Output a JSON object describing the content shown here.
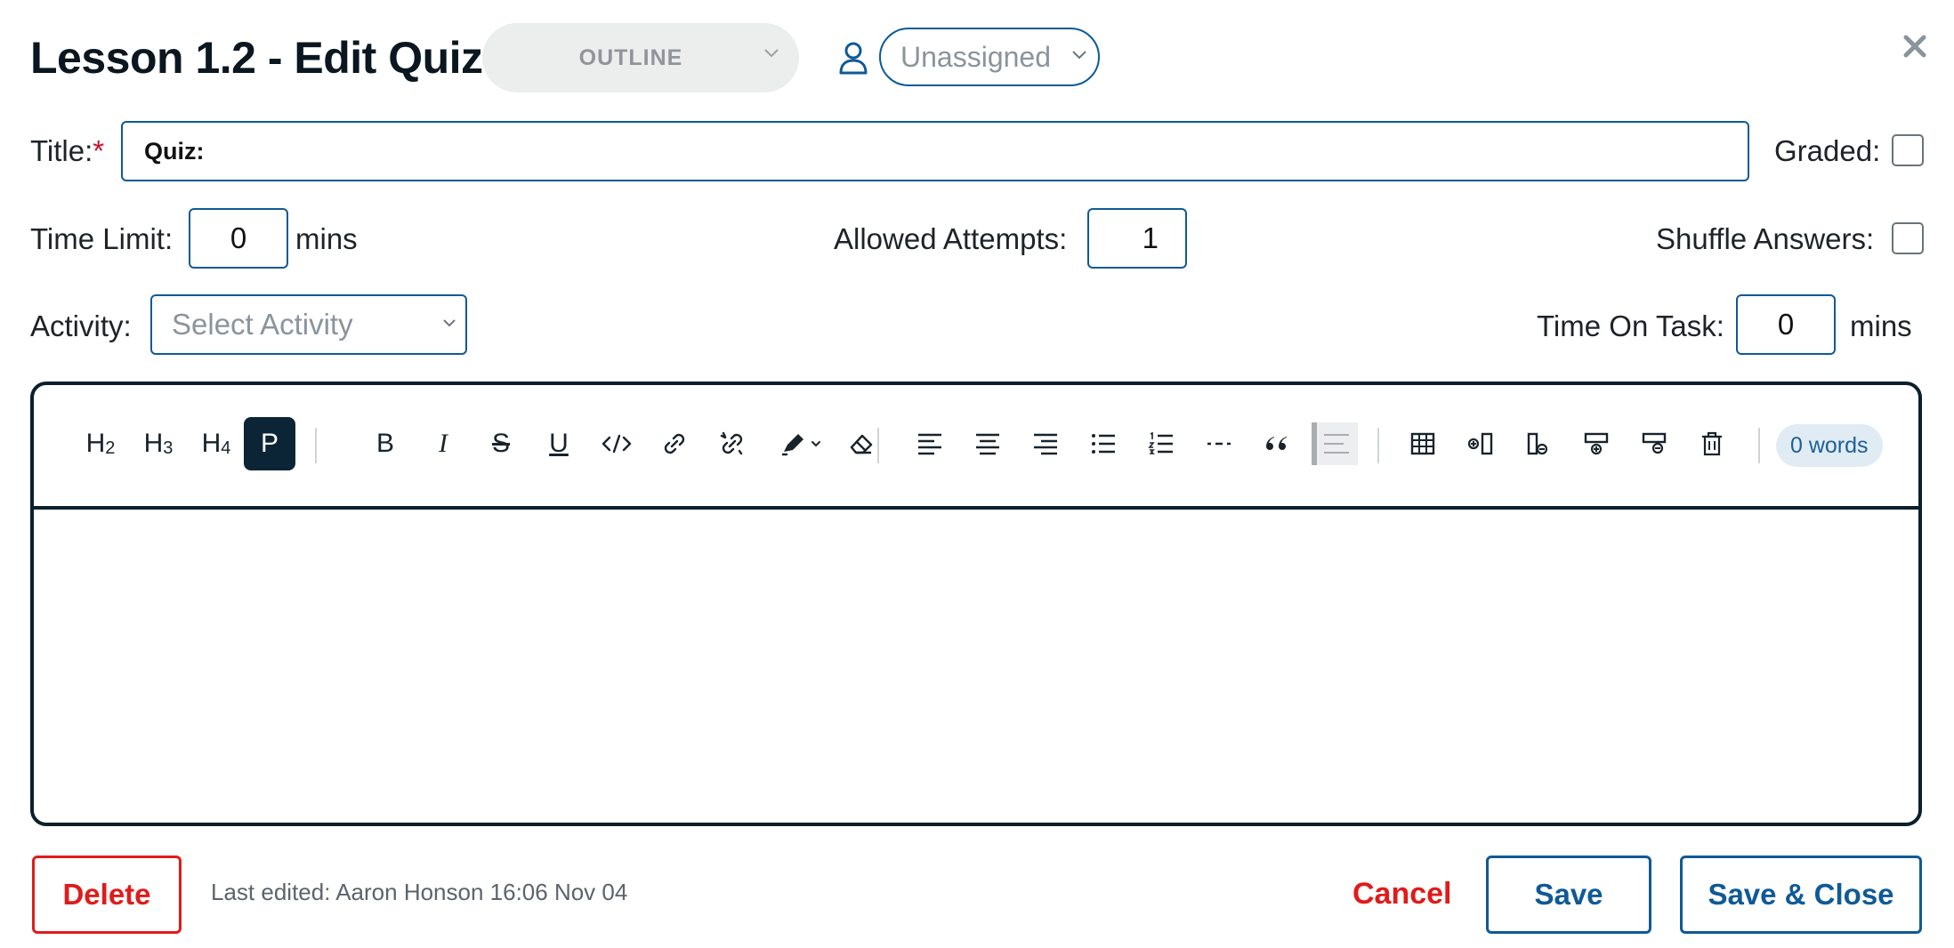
{
  "header": {
    "title": "Lesson 1.2 - Edit Quiz",
    "status": "OUTLINE",
    "assignee": "Unassigned",
    "close_icon": "close-icon"
  },
  "form": {
    "title_label": "Title:",
    "required_mark": "*",
    "title_value": "Quiz:",
    "graded_label": "Graded:",
    "graded_checked": false,
    "time_limit_label": "Time Limit:",
    "time_limit_value": "0",
    "time_limit_unit": "mins",
    "allowed_attempts_label": "Allowed Attempts:",
    "allowed_attempts_value": "1",
    "shuffle_label": "Shuffle Answers:",
    "shuffle_checked": false,
    "activity_label": "Activity:",
    "activity_placeholder": "Select Activity",
    "time_on_task_label": "Time On Task:",
    "time_on_task_value": "0",
    "time_on_task_unit": "mins"
  },
  "editor": {
    "toolbar": {
      "h2": "H",
      "h2_sub": "2",
      "h3": "H",
      "h3_sub": "3",
      "h4": "H",
      "h4_sub": "4",
      "paragraph": "P",
      "bold": "B",
      "italic": "I",
      "strike": "S",
      "underline": "U",
      "word_count": "0 words"
    },
    "content": ""
  },
  "footer": {
    "delete_label": "Delete",
    "last_edited": "Last edited: Aaron Honson 16:06 Nov 04",
    "cancel_label": "Cancel",
    "save_label": "Save",
    "save_close_label": "Save & Close"
  },
  "colors": {
    "primary": "#0f5a96",
    "danger": "#e01b1b",
    "dark": "#0b1f2c",
    "badge_bg": "#e1ebf4"
  }
}
